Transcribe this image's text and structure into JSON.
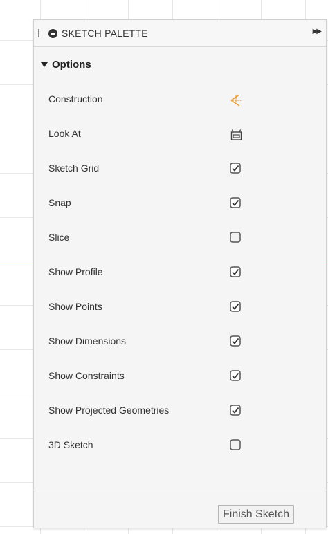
{
  "palette": {
    "title": "SKETCH PALETTE",
    "section_title": "Options",
    "options": [
      {
        "label": "Construction",
        "control": "construction-icon"
      },
      {
        "label": "Look At",
        "control": "look-at-icon"
      },
      {
        "label": "Sketch Grid",
        "control": "checkbox",
        "checked": true
      },
      {
        "label": "Snap",
        "control": "checkbox",
        "checked": true
      },
      {
        "label": "Slice",
        "control": "checkbox",
        "checked": false
      },
      {
        "label": "Show Profile",
        "control": "checkbox",
        "checked": true
      },
      {
        "label": "Show Points",
        "control": "checkbox",
        "checked": true
      },
      {
        "label": "Show Dimensions",
        "control": "checkbox",
        "checked": true
      },
      {
        "label": "Show Constraints",
        "control": "checkbox",
        "checked": true
      },
      {
        "label": "Show Projected Geometries",
        "control": "checkbox",
        "checked": true
      },
      {
        "label": "3D Sketch",
        "control": "checkbox",
        "checked": false
      }
    ],
    "finish_label": "Finish Sketch"
  },
  "colors": {
    "construction_orange": "#f0a030",
    "axis_red": "#e7a19c"
  }
}
